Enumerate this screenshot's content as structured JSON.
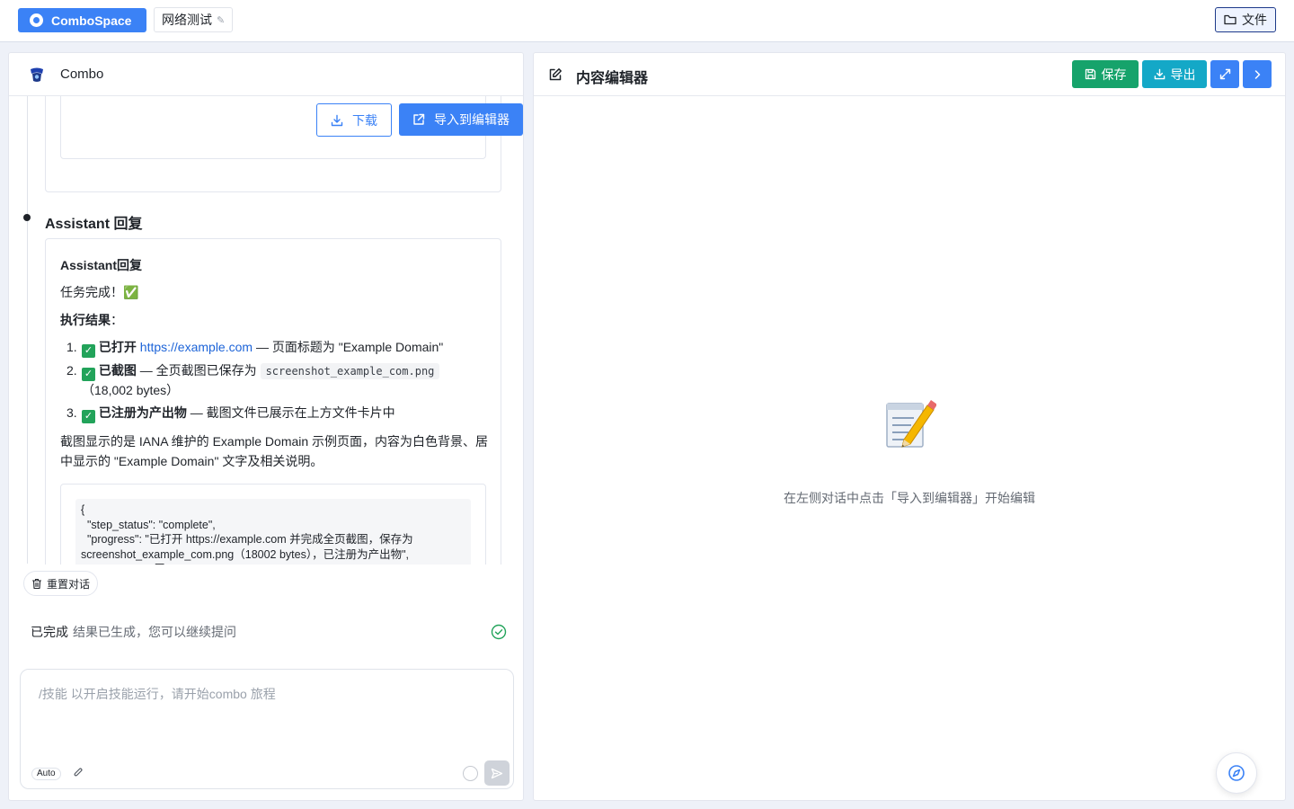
{
  "topbar": {
    "brand": "ComboSpace",
    "project_name": "网络测试",
    "files_label": "文件"
  },
  "left_panel": {
    "title": "Combo",
    "file_card": {
      "download_label": "下载",
      "import_label": "导入到编辑器"
    },
    "reply": {
      "heading": "Assistant 回复",
      "card_title": "Assistant回复",
      "task_done": "任务完成！✅",
      "result_label": "执行结果",
      "result_colon": "：",
      "items": [
        {
          "num": "1.",
          "check": "✓",
          "bold": "已打开",
          "link": "https://example.com",
          "rest": " — 页面标题为 \"Example Domain\""
        },
        {
          "num": "2.",
          "check": "✓",
          "bold": "已截图",
          "rest_pre": " — 全页截图已保存为 ",
          "code": "screenshot_example_com.png",
          "rest": " （18,002 bytes）"
        },
        {
          "num": "3.",
          "check": "✓",
          "bold": "已注册为产出物",
          "rest": " — 截图文件已展示在上方文件卡片中"
        }
      ],
      "summary": "截图显示的是 IANA 维护的 Example Domain 示例页面，内容为白色背景、居中显示的 \"Example Domain\" 文字及相关说明。",
      "code_block": "{\n  \"step_status\": \"complete\",\n  \"progress\": \"已打开 https://example.com 并完成全页截图，保存为 screenshot_example_com.png（18002 bytes），已注册为产出物\",\n  \"next_step\": \"无\""
    },
    "reset_label": "重置对话",
    "status": {
      "main": "已完成",
      "sub": "结果已生成，您可以继续提问"
    },
    "composer": {
      "placeholder": "/技能 以开启技能运行，请开始combo 旅程",
      "mode_badge": "Auto"
    }
  },
  "right_panel": {
    "title": "内容编辑器",
    "save_label": "保存",
    "export_label": "导出",
    "empty_text": "在左侧对话中点击「导入到编辑器」开始编辑"
  },
  "colors": {
    "primary": "#3b82f6",
    "save_green": "#16a36b",
    "export_cyan": "#14a8c7",
    "success_green": "#22a35a"
  },
  "icons": {
    "brand": "brand-logo-icon",
    "files": "folder-icon",
    "combo": "combo-logo-icon",
    "download": "download-icon",
    "import": "external-link-icon",
    "reset": "trash-icon",
    "status": "check-circle-icon",
    "attach": "paperclip-icon",
    "send": "send-icon",
    "edit": "edit-icon",
    "save": "floppy-disk-icon",
    "export": "download-icon",
    "expand": "expand-icon",
    "next": "chevron-right-icon",
    "empty": "memo-icon",
    "fab": "compass-icon"
  }
}
